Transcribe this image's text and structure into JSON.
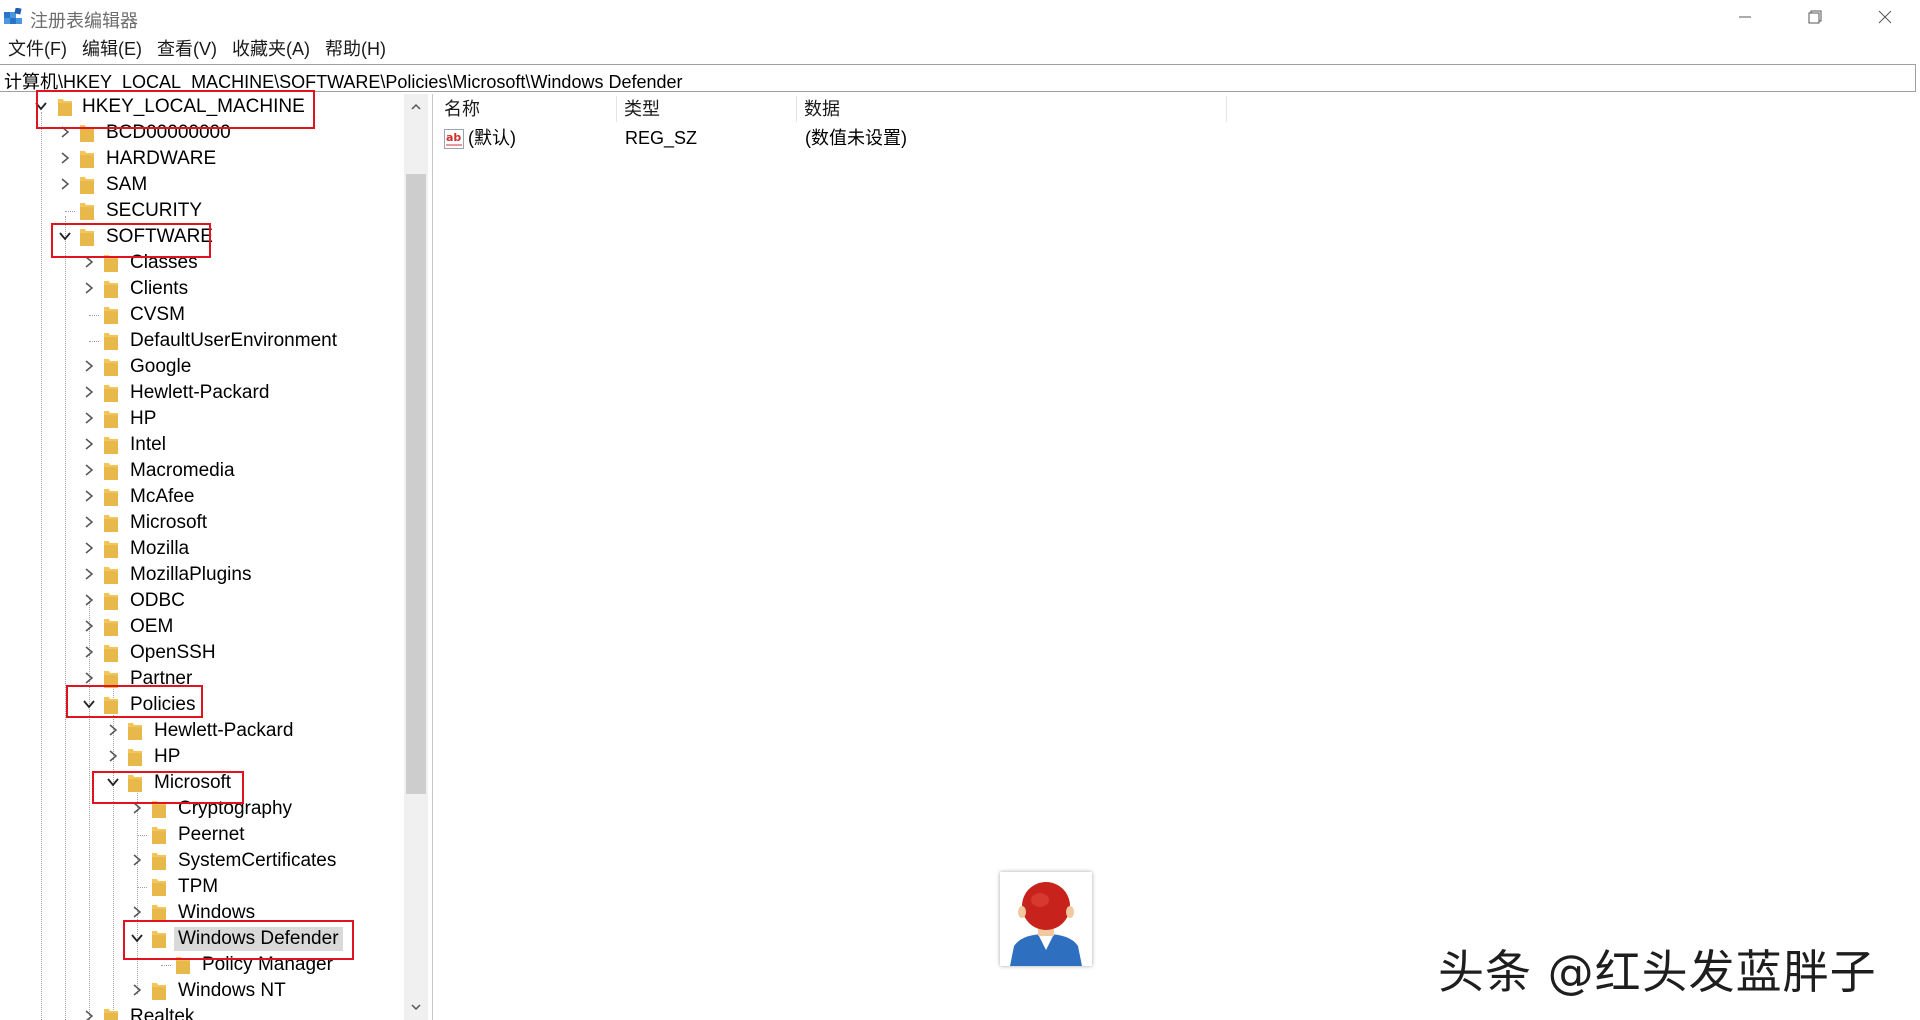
{
  "window": {
    "title": "注册表编辑器"
  },
  "menu": [
    "文件(F)",
    "编辑(E)",
    "查看(V)",
    "收藏夹(A)",
    "帮助(H)"
  ],
  "address": "计算机\\HKEY_LOCAL_MACHINE\\SOFTWARE\\Policies\\Microsoft\\Windows Defender",
  "tree": {
    "hklm": "HKEY_LOCAL_MACHINE",
    "l1": [
      "BCD00000000",
      "HARDWARE",
      "SAM",
      "SECURITY",
      "SOFTWARE"
    ],
    "software_children": [
      "Classes",
      "Clients",
      "CVSM",
      "DefaultUserEnvironment",
      "Google",
      "Hewlett-Packard",
      "HP",
      "Intel",
      "Macromedia",
      "McAfee",
      "Microsoft",
      "Mozilla",
      "MozillaPlugins",
      "ODBC",
      "OEM",
      "OpenSSH",
      "Partner",
      "Policies"
    ],
    "policies_children": [
      "Hewlett-Packard",
      "HP",
      "Microsoft"
    ],
    "ms_children": [
      "Cryptography",
      "Peernet",
      "SystemCertificates",
      "TPM",
      "Windows",
      "Windows Defender"
    ],
    "defender_children": [
      "Policy Manager"
    ],
    "after_defender": [
      "Windows NT"
    ],
    "next_l2": "Realtek",
    "selected": "Windows Defender"
  },
  "columns": [
    "名称",
    "类型",
    "数据"
  ],
  "values": [
    {
      "name": "(默认)",
      "type": "REG_SZ",
      "data": "(数值未设置)"
    }
  ],
  "watermark": "头条 @红头发蓝胖子",
  "colors": {
    "highlight": "#e0141e",
    "selected_bg": "#d9d9d9",
    "folder": "#e8b84a"
  }
}
